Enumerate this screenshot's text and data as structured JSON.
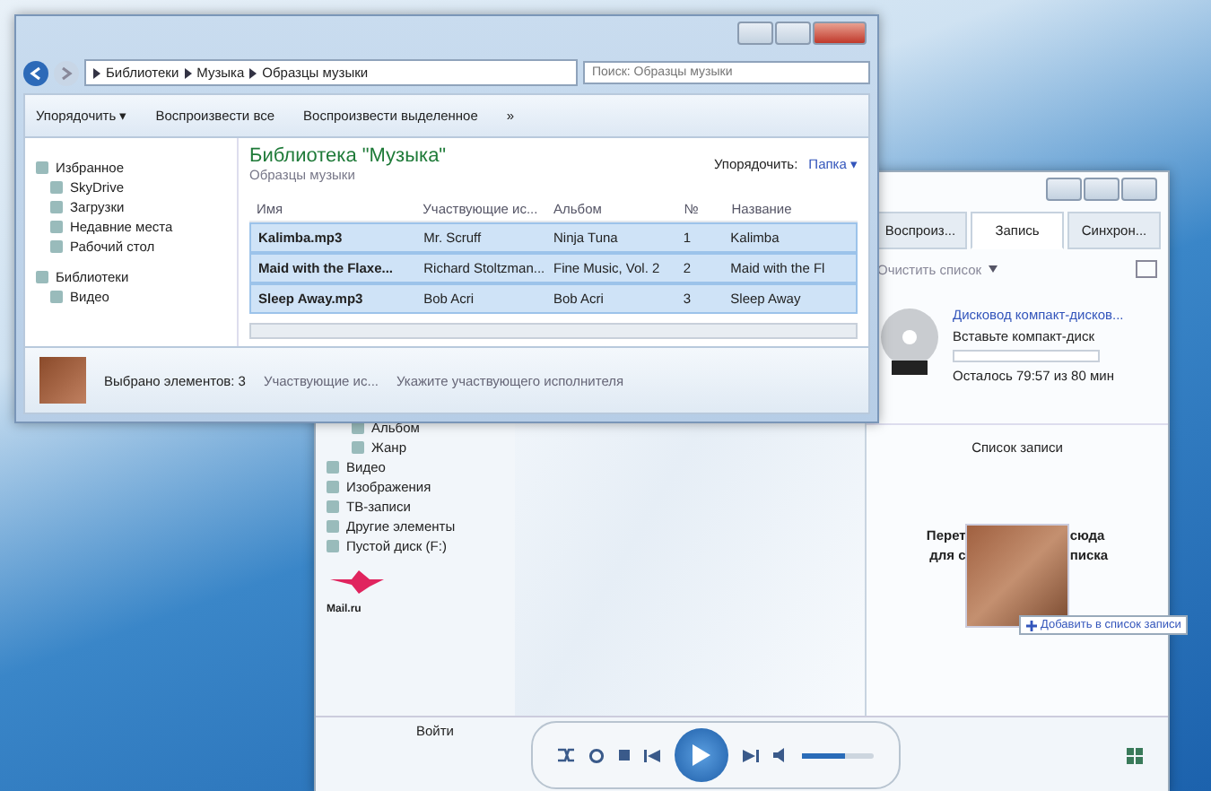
{
  "explorer": {
    "breadcrumb": [
      "Библиотеки",
      "Музыка",
      "Образцы музыки"
    ],
    "search": {
      "placeholder": "Поиск: Образцы музыки"
    },
    "toolbar": [
      "Упорядочить ▾",
      "Воспроизвести все",
      "Воспроизвести выделенное",
      "»"
    ],
    "nav": [
      {
        "label": "Избранное",
        "kind": "group"
      },
      {
        "label": "SkyDrive",
        "kind": "item"
      },
      {
        "label": "Загрузки",
        "kind": "item"
      },
      {
        "label": "Недавние места",
        "kind": "item"
      },
      {
        "label": "Рабочий стол",
        "kind": "item"
      },
      {
        "label": "Библиотеки",
        "kind": "group"
      },
      {
        "label": "Видео",
        "kind": "item"
      }
    ],
    "library_title": "Библиотека \"Музыка\"",
    "library_subtitle": "Образцы музыки",
    "arrange_label": "Упорядочить:",
    "arrange_value": "Папка ▾",
    "columns": [
      "Имя",
      "Участвующие ис...",
      "Альбом",
      "№",
      "Название"
    ],
    "rows": [
      {
        "cells": [
          "Kalimba.mp3",
          "Mr. Scruff",
          "Ninja Tuna",
          "1",
          "Kalimba"
        ],
        "selected": true
      },
      {
        "cells": [
          "Maid with the Flaxe...",
          "Richard Stoltzman...",
          "Fine Music, Vol. 2",
          "2",
          "Maid with the Fl"
        ],
        "selected": true
      },
      {
        "cells": [
          "Sleep Away.mp3",
          "Bob Acri",
          "Bob Acri",
          "3",
          "Sleep Away"
        ],
        "selected": true
      }
    ],
    "status": {
      "count": "Выбрано элементов: 3",
      "field": "Участвующие ис...",
      "hint": "Укажите участвующего исполнителя"
    }
  },
  "player": {
    "tabs": [
      {
        "label": "Воспроиз...",
        "selected": false
      },
      {
        "label": "Запись",
        "selected": true
      },
      {
        "label": "Синхрон...",
        "selected": false
      }
    ],
    "list_action": "Очистить список",
    "drive": "Дисковод компакт-дисков...",
    "insert": "Вставьте компакт-диск",
    "remaining": "Осталось 79:57 из 80 мин",
    "list_title": "Список записи",
    "drop_left": [
      "Перет",
      "для с"
    ],
    "drop_right": [
      "сюда",
      "писка"
    ],
    "tooltip": "Добавить в список записи",
    "nav": [
      {
        "label": "Альбом",
        "kind": "sub"
      },
      {
        "label": "Жанр",
        "kind": "sub"
      },
      {
        "label": "Видео",
        "kind": "item"
      },
      {
        "label": "Изображения",
        "kind": "item"
      },
      {
        "label": "ТВ-записи",
        "kind": "item"
      },
      {
        "label": "Другие элементы",
        "kind": "item"
      },
      {
        "label": "Пустой диск (F:)",
        "kind": "item"
      }
    ],
    "logo_text": "Mail.ru",
    "sign_in": "Войти",
    "volume": {
      "level": 0.6
    }
  }
}
